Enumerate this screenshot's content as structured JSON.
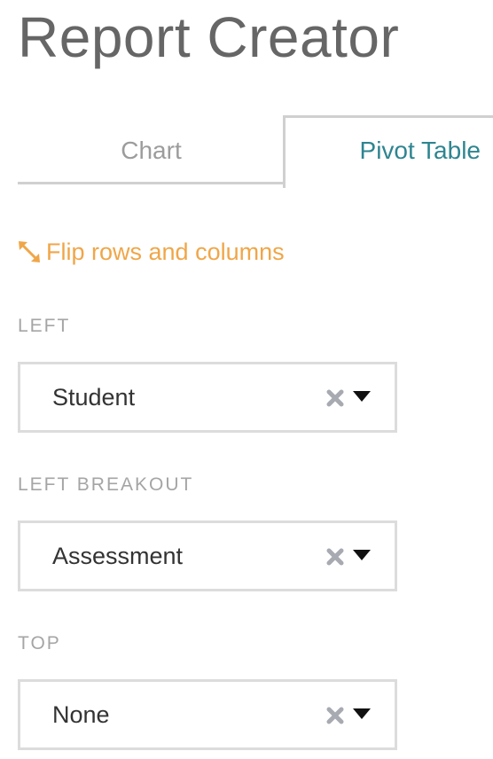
{
  "header": {
    "title": "Report Creator"
  },
  "tabs": [
    {
      "label": "Chart",
      "active": false
    },
    {
      "label": "Pivot Table",
      "active": true
    }
  ],
  "flip_link": {
    "label": "Flip rows and columns",
    "icon": "expand-arrows-icon"
  },
  "fields": [
    {
      "label": "LEFT",
      "value": "Student"
    },
    {
      "label": "LEFT BREAKOUT",
      "value": "Assessment"
    },
    {
      "label": "TOP",
      "value": "None"
    }
  ],
  "colors": {
    "title": "#666666",
    "active_tab": "#2e8590",
    "inactive_tab": "#9c9c9c",
    "link": "#f0a648",
    "section_label": "#a5a5a5",
    "border": "#d0d0d0",
    "clear_icon": "#a8aab2"
  }
}
